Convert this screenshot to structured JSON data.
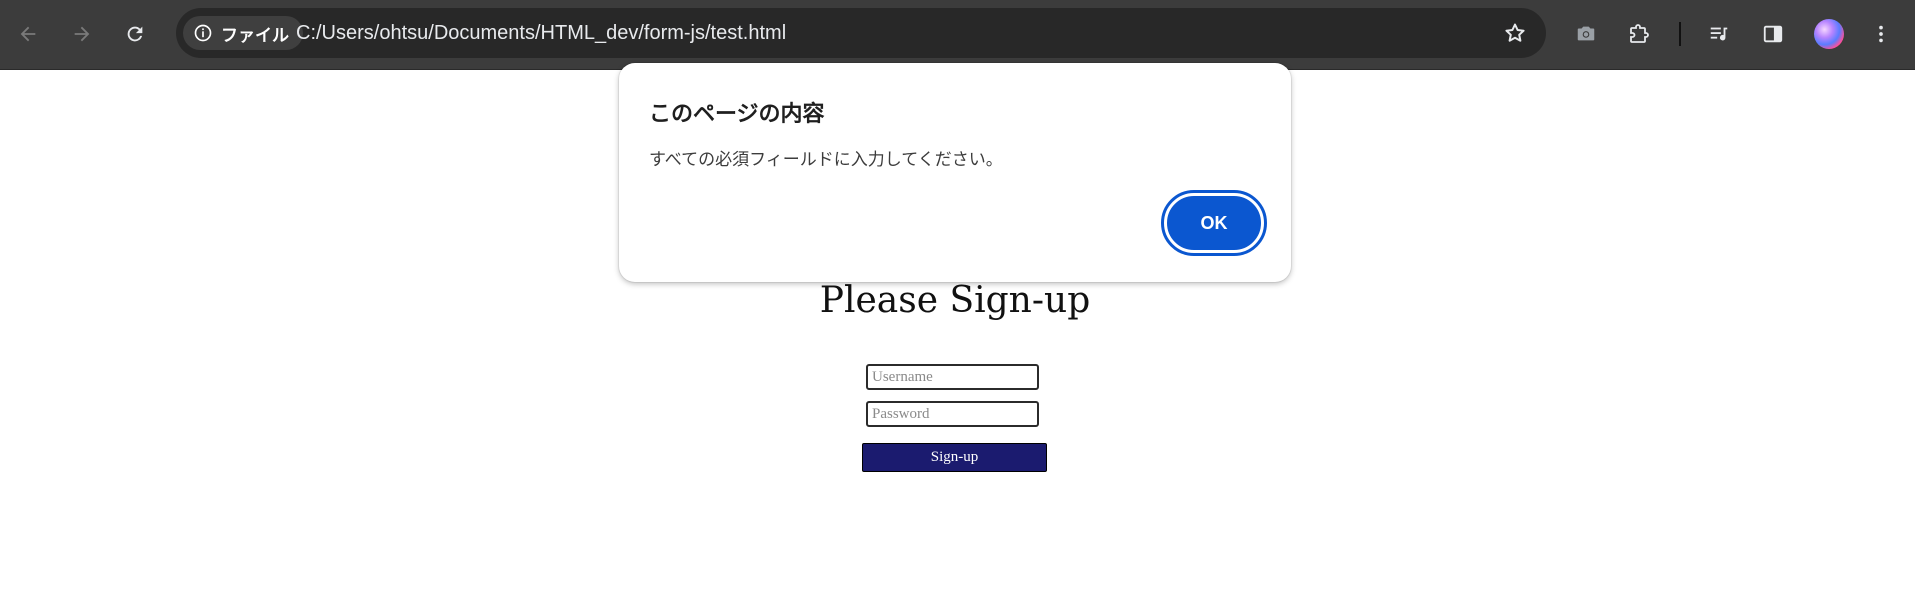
{
  "browser": {
    "security_chip_label": "ファイル",
    "url": "C:/Users/ohtsu/Documents/HTML_dev/form-js/test.html",
    "icons": [
      "back-icon",
      "forward-icon",
      "reload-icon",
      "info-icon",
      "star-icon",
      "camera-icon",
      "extensions-icon",
      "media-icon",
      "side-panel-icon",
      "avatar",
      "more-icon"
    ]
  },
  "page": {
    "title": "Please Sign-up",
    "username_placeholder": "Username",
    "password_placeholder": "Password",
    "signup_label": "Sign-up"
  },
  "dialog": {
    "title": "このページの内容",
    "message": "すべての必須フィールドに入力してください。",
    "ok_label": "OK"
  },
  "colors": {
    "toolbar_bg": "#3c3c3c",
    "omnibox_bg": "#282828",
    "ok_button": "#0b57d0",
    "signup_button": "#1b1b6f"
  }
}
